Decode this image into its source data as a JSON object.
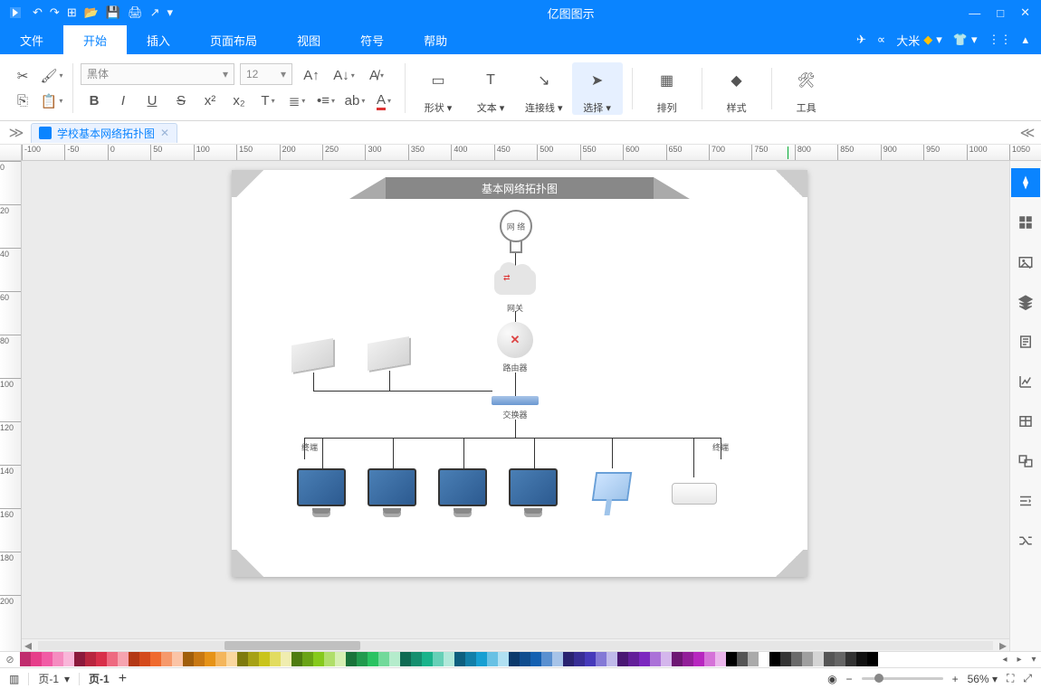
{
  "app": {
    "title": "亿图图示"
  },
  "qat": {
    "items": [
      "↶",
      "↷",
      "⊞",
      "📂",
      "💾",
      "🖨",
      "↗",
      "▾"
    ]
  },
  "window": {
    "min": "—",
    "max": "□",
    "close": "✕"
  },
  "menu": {
    "tabs": [
      "文件",
      "开始",
      "插入",
      "页面布局",
      "视图",
      "符号",
      "帮助"
    ],
    "active_index": 1,
    "right": {
      "send": "✈",
      "share": "∝",
      "user": "大米",
      "crown": "◆",
      "dd": "▾",
      "shirt": "👕",
      "dd2": "▾",
      "grid": "⋮⋮",
      "up": "▴"
    }
  },
  "ribbon": {
    "font_name": "黑体",
    "font_size": "12",
    "heads": [
      {
        "key": "shape",
        "label": "形状",
        "dd": true
      },
      {
        "key": "text",
        "label": "文本",
        "dd": true
      },
      {
        "key": "connector",
        "label": "连接线",
        "dd": true
      },
      {
        "key": "select",
        "label": "选择",
        "dd": true,
        "active": true
      },
      {
        "key": "arrange",
        "label": "排列"
      },
      {
        "key": "style",
        "label": "样式"
      },
      {
        "key": "tools",
        "label": "工具"
      }
    ]
  },
  "doctab": {
    "name": "学校基本网络拓扑图"
  },
  "ruler_h": [
    -100,
    -50,
    0,
    50,
    100,
    150,
    200,
    250,
    300,
    350,
    400,
    450,
    500,
    550,
    600,
    650,
    700,
    750,
    800,
    850,
    900,
    950,
    1000,
    1050
  ],
  "ruler_v": [
    0,
    20,
    40,
    60,
    80,
    100,
    120,
    140,
    160,
    180,
    200
  ],
  "diagram": {
    "title": "基本网络拓扑图",
    "bulb": "网 络",
    "gateway": "网关",
    "router": "路由器",
    "switch": "交换器",
    "terminal_l": "终端",
    "terminal_r": "终端"
  },
  "dock": [
    "theme",
    "grid",
    "image",
    "layers",
    "outline",
    "chart",
    "table",
    "symbols",
    "align",
    "shuffle"
  ],
  "palette_colors": [
    "#c02c6e",
    "#e63e8a",
    "#f15ca5",
    "#f58cc0",
    "#f9b6d9",
    "#8b1a3c",
    "#b8263f",
    "#d8304a",
    "#ee6a80",
    "#f6a3af",
    "#b33815",
    "#d44a1c",
    "#ef6a2e",
    "#f6996b",
    "#fbc4a6",
    "#a05e0b",
    "#c87812",
    "#e69317",
    "#f4b65c",
    "#fad79f",
    "#7e7a0d",
    "#a6a114",
    "#c9c41b",
    "#e2dc60",
    "#f0edb0",
    "#4f7c10",
    "#6aa316",
    "#86c91d",
    "#b0de6a",
    "#d6efb2",
    "#1a733a",
    "#229a4e",
    "#2bc262",
    "#72d99a",
    "#b5eccc",
    "#106b53",
    "#158f6f",
    "#1ab38b",
    "#66d0b7",
    "#b0e8da",
    "#0d5f7e",
    "#127fa8",
    "#179fd2",
    "#68c1e4",
    "#b0e0f2",
    "#0c3a6b",
    "#104d8e",
    "#1561b1",
    "#5a90d0",
    "#a6c3e8",
    "#2a2370",
    "#382e95",
    "#463aba",
    "#8479d6",
    "#c0baea",
    "#4a1773",
    "#631f99",
    "#7c27bf",
    "#ab72d8",
    "#d4b6ec",
    "#6d1773",
    "#921f99",
    "#b727bf",
    "#d572d8",
    "#ebb6ec",
    "#000000",
    "#555555",
    "#aaaaaa",
    "#ffffff",
    "#000000",
    "#353535",
    "#6a6a6a",
    "#9f9f9f",
    "#d4d4d4",
    "#555555",
    "#656565",
    "#323232",
    "#101010",
    "#000000"
  ],
  "status": {
    "pages_btn": "▥",
    "page_sel": "页-1",
    "page_active": "页-1",
    "add": "+",
    "play": "▶",
    "minus": "−",
    "plus": "+",
    "zoom": "56%",
    "dd": "▾",
    "fit": "⛶",
    "full": "⤢"
  }
}
